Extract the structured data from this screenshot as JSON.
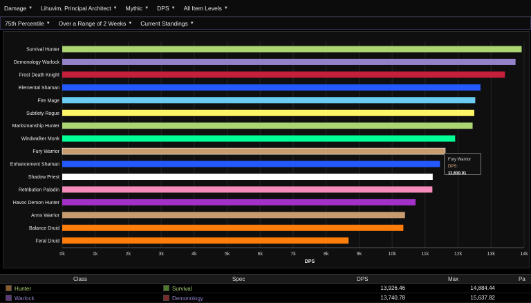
{
  "filters_top": [
    {
      "label": "Damage"
    },
    {
      "label": "Lihuvim, Principal Architect"
    },
    {
      "label": "Mythic"
    },
    {
      "label": "DPS"
    },
    {
      "label": "All Item Levels"
    }
  ],
  "filters_sub": [
    {
      "label": "75th Percentile"
    },
    {
      "label": "Over a Range of 2 Weeks"
    },
    {
      "label": "Current Standings"
    }
  ],
  "chart_data": {
    "type": "bar",
    "orientation": "horizontal",
    "categories": [
      "Survival Hunter",
      "Demonology Warlock",
      "Frost Death Knight",
      "Elemental Shaman",
      "Fire Mage",
      "Subtlety Rogue",
      "Marksmanship Hunter",
      "Windwalker Monk",
      "Fury Warrior",
      "Enhancement Shaman",
      "Shadow Priest",
      "Retribution Paladin",
      "Havoc Demon Hunter",
      "Arms Warrior",
      "Balance Druid",
      "Feral Druid"
    ],
    "values": [
      13926.46,
      13740.78,
      13420,
      12680,
      12520,
      12490,
      12440,
      11910,
      11610.01,
      11450,
      11230,
      11220,
      10710,
      10390,
      10340,
      8680
    ],
    "colors": [
      "#abd473",
      "#9482c9",
      "#c41f3b",
      "#2459ff",
      "#69ccf0",
      "#fff569",
      "#abd473",
      "#00ff96",
      "#c79c6e",
      "#2459ff",
      "#ffffff",
      "#f58cba",
      "#a330c9",
      "#c79c6e",
      "#ff7d0a",
      "#ff7d0a"
    ],
    "xticks": [
      "0k",
      "1k",
      "2k",
      "3k",
      "4k",
      "5k",
      "6k",
      "7k",
      "8k",
      "9k",
      "10k",
      "11k",
      "12k",
      "13k",
      "14k"
    ],
    "xlim": [
      0,
      14000
    ],
    "xlabel": "DPS",
    "ylabel": "",
    "title": "",
    "grid": true,
    "highlight_index": 8
  },
  "tooltip": {
    "title": "Fury Warrior",
    "key": "DPS:",
    "value": "11,610.01"
  },
  "table": {
    "headers": [
      "Class",
      "Spec",
      "DPS",
      "Max",
      "Pa"
    ],
    "rows": [
      {
        "class": "Hunter",
        "class_color": "#abd473",
        "spec": "Survival",
        "spec_color": "#abd473",
        "dps": "13,926.46",
        "max": "14,884.44"
      },
      {
        "class": "Warlock",
        "class_color": "#9482c9",
        "spec": "Demonology",
        "spec_color": "#9482c9",
        "dps": "13,740.78",
        "max": "15,637.82"
      }
    ]
  }
}
